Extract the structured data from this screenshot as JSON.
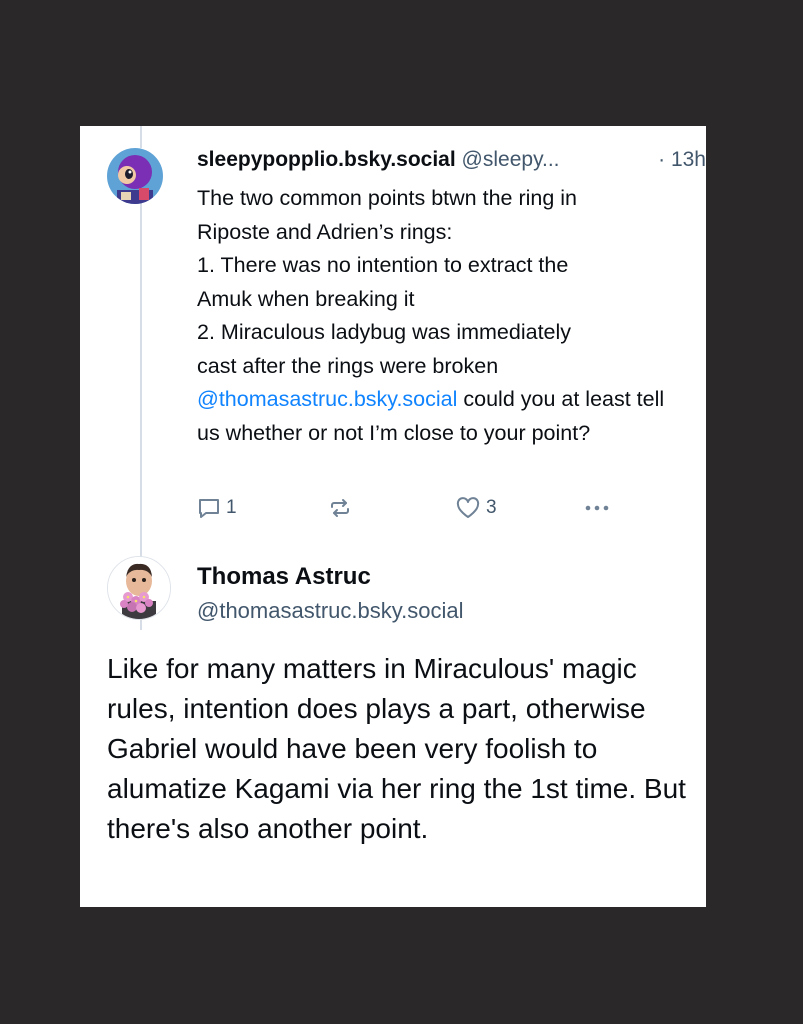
{
  "parent_post": {
    "display_name": "sleepypopplio.bsky.social",
    "handle": "@sleepy...",
    "timestamp": "· 13h",
    "body_lines": [
      "The two common points btwn the ring in",
      "Riposte and Adrien’s rings:",
      "1. There was no intention to extract the",
      "Amuk when breaking it",
      "2. Miraculous ladybug was immediately",
      "cast after the rings were broken"
    ],
    "mention": "@thomasastruc.bsky.social",
    "body_after_mention": " could you at least tell us whether or not I’m close to your point?",
    "actions": {
      "reply_icon": "comment-icon",
      "reply_count": "1",
      "repost_icon": "repost-icon",
      "like_icon": "heart-icon",
      "like_count": "3",
      "more_icon": "more-dots-icon"
    }
  },
  "reply_post": {
    "display_name": "Thomas Astruc",
    "handle": "@thomasastruc.bsky.social",
    "body": "Like for many matters in Miraculous' magic rules, intention does plays a part, otherwise Gabriel would have been very foolish to alumatize Kagami via her ring the 1st time. But there's also another point."
  },
  "colors": {
    "background": "#2a2828",
    "card": "#ffffff",
    "text": "#0b0f14",
    "muted": "#42576c",
    "link": "#1083fe",
    "thread_line": "#d6dde6"
  }
}
